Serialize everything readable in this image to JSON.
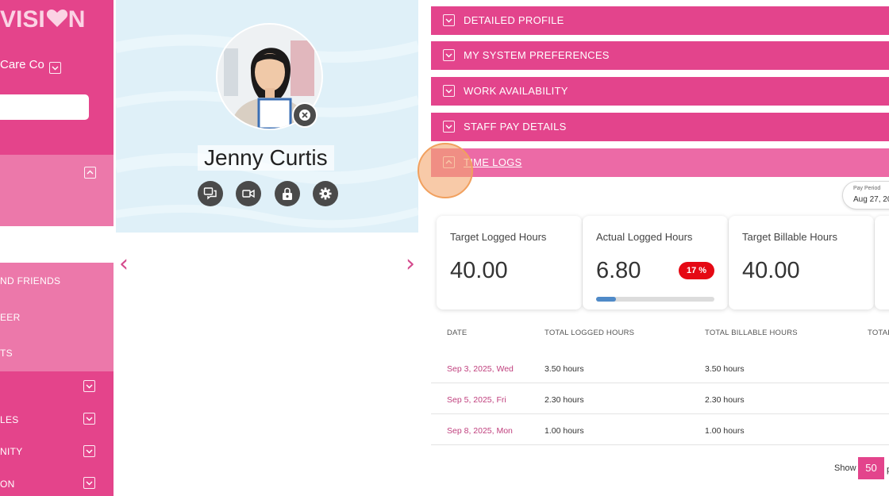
{
  "sidebar": {
    "logo_text": "VISI",
    "logo_text_end": "N",
    "org_name": "Care Co",
    "search_value": "",
    "items": [
      {
        "label": "ND FRIENDS"
      },
      {
        "label": "EER"
      },
      {
        "label": "TS"
      },
      {
        "label": ""
      },
      {
        "label": "LES"
      },
      {
        "label": "NITY"
      },
      {
        "label": "ON"
      }
    ]
  },
  "profile": {
    "name": "Jenny Curtis",
    "actions": [
      "chat-icon",
      "video-icon",
      "lock-icon",
      "settings-icon"
    ]
  },
  "carousel": {
    "prev": "‹",
    "next": "›"
  },
  "accordion": [
    {
      "label": "DETAILED PROFILE",
      "open": false
    },
    {
      "label": "MY SYSTEM PREFERENCES",
      "open": false
    },
    {
      "label": "WORK AVAILABILITY",
      "open": false
    },
    {
      "label": "STAFF PAY DETAILS",
      "open": false
    },
    {
      "label": "TIME LOGS",
      "open": true
    }
  ],
  "pay_period": {
    "label": "Pay Period",
    "value": "Aug 27, 20"
  },
  "stats": [
    {
      "label": "Target Logged Hours",
      "value": "40.00"
    },
    {
      "label": "Actual Logged Hours",
      "value": "6.80",
      "badge": "17 %",
      "progress_pct": 17
    },
    {
      "label": "Target Billable Hours",
      "value": "40.00"
    }
  ],
  "table": {
    "headers": [
      "DATE",
      "TOTAL LOGGED HOURS",
      "TOTAL BILLABLE HOURS",
      "TOTAL"
    ],
    "rows": [
      {
        "date": "Sep 3, 2025, Wed",
        "logged": "3.50 hours",
        "billable": "3.50 hours"
      },
      {
        "date": "Sep 5, 2025, Fri",
        "logged": "2.30 hours",
        "billable": "2.30 hours"
      },
      {
        "date": "Sep 8, 2025, Mon",
        "logged": "1.00 hours",
        "billable": "1.00 hours"
      }
    ]
  },
  "pagination": {
    "show_label": "Show",
    "page_size": "50",
    "tail": "p"
  },
  "colors": {
    "brand_pink": "#e3448c",
    "light_pink": "#ec78aa",
    "badge_red": "#e50914",
    "progress_blue": "#4f8ac8"
  }
}
